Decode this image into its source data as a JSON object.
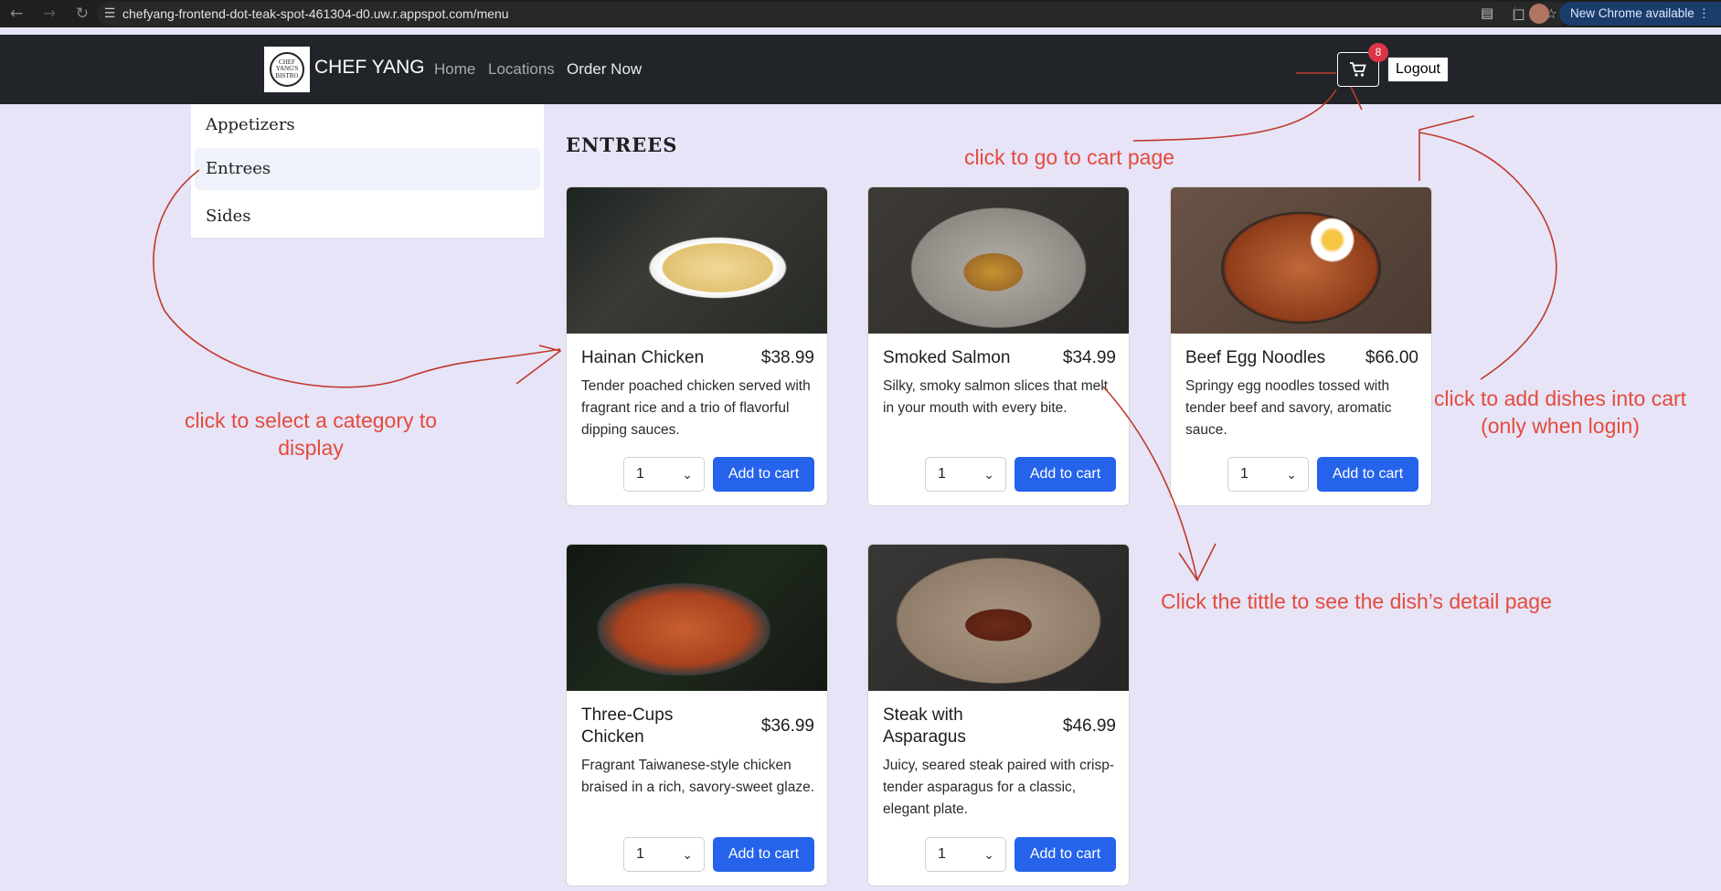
{
  "browser": {
    "url": "chefyang-frontend-dot-teak-spot-461304-d0.uw.r.appspot.com/menu",
    "update_label": "New Chrome available",
    "back_icon": "back-arrow-icon",
    "forward_icon": "forward-arrow-icon",
    "reload_icon": "reload-icon"
  },
  "navbar": {
    "logo_text": "CHEF YANG'S BISTRO",
    "brand": "CHEF YANG",
    "links": [
      "Home",
      "Locations",
      "Order Now"
    ],
    "cart_count": "8",
    "logout_label": "Logout"
  },
  "categories": [
    "Appetizers",
    "Entrees",
    "Sides"
  ],
  "selected_category": "Entrees",
  "section_title": "ENTREES",
  "dishes": [
    {
      "name": "Hainan Chicken",
      "price": "$38.99",
      "description": "Tender poached chicken served with fragrant rice and a trio of flavorful dipping sauces.",
      "qty": "1",
      "button": "Add to cart"
    },
    {
      "name": "Smoked Salmon",
      "price": "$34.99",
      "description": "Silky, smoky salmon slices that melt in your mouth with every bite.",
      "qty": "1",
      "button": "Add to cart"
    },
    {
      "name": "Beef Egg Noodles",
      "price": "$66.00",
      "description": "Springy egg noodles tossed with tender beef and savory, aromatic sauce.",
      "qty": "1",
      "button": "Add to cart"
    },
    {
      "name": "Three-Cups Chicken",
      "price": "$36.99",
      "description": "Fragrant Taiwanese-style chicken braised in a rich, savory-sweet glaze.",
      "qty": "1",
      "button": "Add to cart"
    },
    {
      "name": "Steak with Asparagus",
      "price": "$46.99",
      "description": "Juicy, seared steak paired with crisp-tender asparagus for a classic, elegant plate.",
      "qty": "1",
      "button": "Add to cart"
    }
  ],
  "annotations": {
    "cart_page": "click to go to cart page",
    "category_line1": "click to select a category to",
    "category_line2": "display",
    "add_line1": "click to add dishes into cart",
    "add_line2": "(only when login)",
    "title_detail": "Click the tittle to see the dish’s detail page"
  },
  "colors": {
    "accent": "#2563eb",
    "navbar": "#212529",
    "annotation": "#e44b3d",
    "badge": "#dc3545",
    "page_bg": "#e7e4f7"
  }
}
